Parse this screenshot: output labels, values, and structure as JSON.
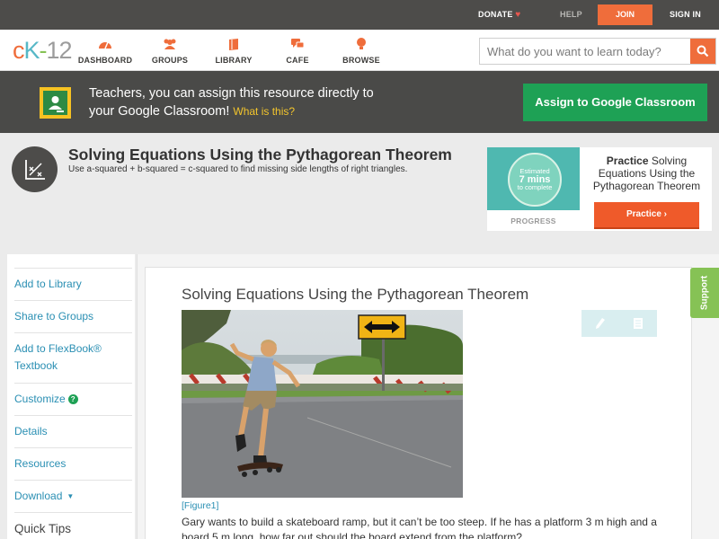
{
  "topbar": {
    "donate": "DONATE",
    "help": "HELP",
    "join": "JOIN",
    "signin": "SIGN IN"
  },
  "logo": {
    "c": "c",
    "k": "K",
    "dash": "-",
    "n": "12"
  },
  "nav": [
    {
      "label": "DASHBOARD",
      "icon": "dashboard-icon"
    },
    {
      "label": "GROUPS",
      "icon": "groups-icon"
    },
    {
      "label": "LIBRARY",
      "icon": "library-icon"
    },
    {
      "label": "CAFE",
      "icon": "cafe-icon"
    },
    {
      "label": "BROWSE",
      "icon": "browse-icon"
    }
  ],
  "search": {
    "placeholder": "What do you want to learn today?"
  },
  "banner": {
    "line1": "Teachers, you can assign this resource directly to",
    "line2": "your Google Classroom!",
    "what": "What is this?",
    "button": "Assign to Google Classroom"
  },
  "page": {
    "title": "Solving Equations Using the Pythagorean Theorem",
    "subtitle": "Use a-squared + b-squared = c-squared to find missing side lengths of right triangles."
  },
  "practice": {
    "estimated": "Estimated",
    "mins": "7 mins",
    "complete": "to complete",
    "progress": "PROGRESS",
    "title_bold": "Practice",
    "title_rest": "Solving Equations Using the Pythagorean Theorem",
    "button": "Practice"
  },
  "sidebar": {
    "items": [
      {
        "label": "Add to Library"
      },
      {
        "label": "Share to Groups"
      },
      {
        "label": "Add to FlexBook®"
      },
      {
        "label": "Customize"
      },
      {
        "label": "Details"
      },
      {
        "label": "Resources"
      },
      {
        "label": "Download"
      }
    ],
    "flexbook_line2": "Textbook",
    "help_badge": "?",
    "caret": "▼",
    "quick_tips": "Quick Tips"
  },
  "content": {
    "title": "Solving Equations Using the Pythagorean Theorem",
    "figure": "[Figure1]",
    "para": "Gary wants to build a skateboard ramp, but it can’t be too steep. If he has a platform 3 m high and a board 5 m long, how far out should the board extend from the platform?"
  },
  "support": "Support",
  "colors": {
    "accent_orange": "#ef6d3b",
    "link_blue": "#2a8fb3",
    "green": "#1ea155",
    "support_green": "#86c255",
    "dark_bar": "#4d4c4a"
  }
}
